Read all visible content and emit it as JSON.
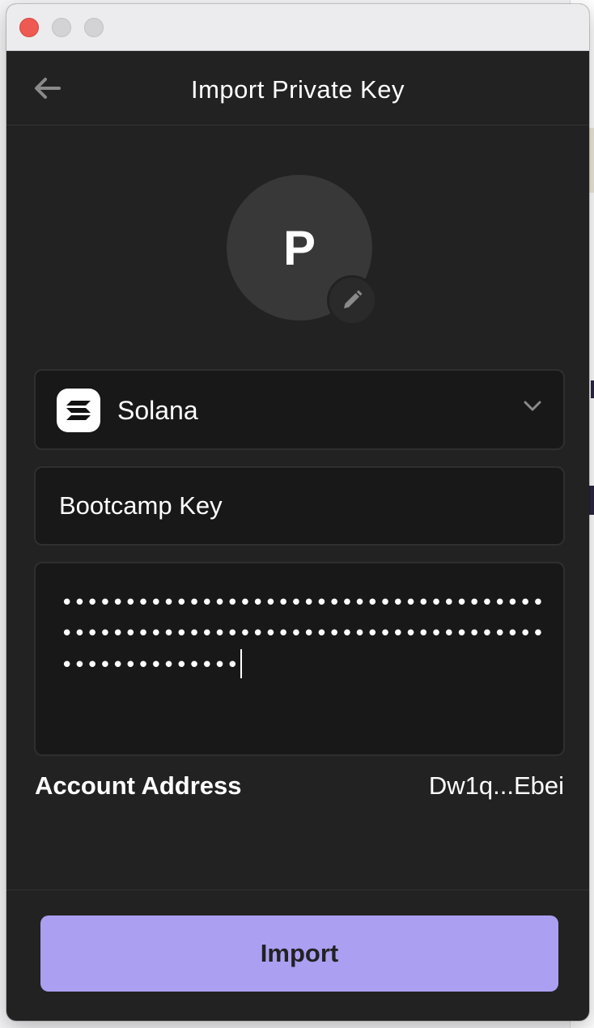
{
  "window": {
    "controls": [
      "close",
      "minimize",
      "maximize"
    ]
  },
  "header": {
    "title": "Import Private Key",
    "back_icon": "arrow-left-icon"
  },
  "avatar": {
    "initial": "P",
    "edit_icon": "pencil-icon"
  },
  "network_select": {
    "selected": "Solana",
    "logo_icon": "solana-logo-icon",
    "dropdown_icon": "chevron-down-icon"
  },
  "account_name": {
    "value": "Bootcamp Key"
  },
  "private_key": {
    "masked_value": "••••••••••••••••••••••••••••••••••••••••••••••••••••••••••••••••••••••••••••••••••••••••••"
  },
  "account_address": {
    "label": "Account Address",
    "value": "Dw1q...Ebei"
  },
  "footer": {
    "import_label": "Import"
  },
  "colors": {
    "accent": "#ab9ff2",
    "background": "#222222",
    "field_background": "#181818"
  }
}
